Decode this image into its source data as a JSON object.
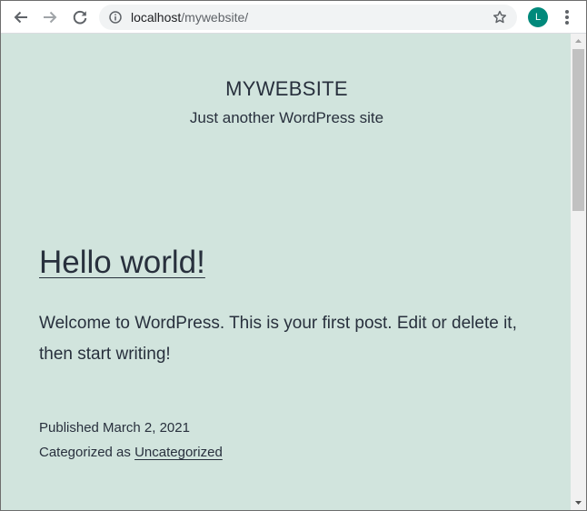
{
  "browser": {
    "url_host": "localhost",
    "url_path": "/mywebsite/",
    "avatar_letter": "L",
    "avatar_color": "#00897b",
    "icons": {
      "back": "arrow-left-icon",
      "forward": "arrow-right-icon",
      "reload": "reload-icon",
      "info": "info-circle-icon",
      "bookmark": "star-outline-icon",
      "menu": "kebab-menu-icon"
    }
  },
  "site": {
    "title": "MYWEBSITE",
    "description": "Just another WordPress site",
    "background_color": "#d1e4dd",
    "text_color": "#28303d"
  },
  "post": {
    "title": "Hello world!",
    "body": "Welcome to WordPress. This is your first post. Edit or delete it, then start writing!",
    "published_text": "Published March 2, 2021",
    "categorized_prefix": "Categorized as",
    "category": "Uncategorized"
  }
}
